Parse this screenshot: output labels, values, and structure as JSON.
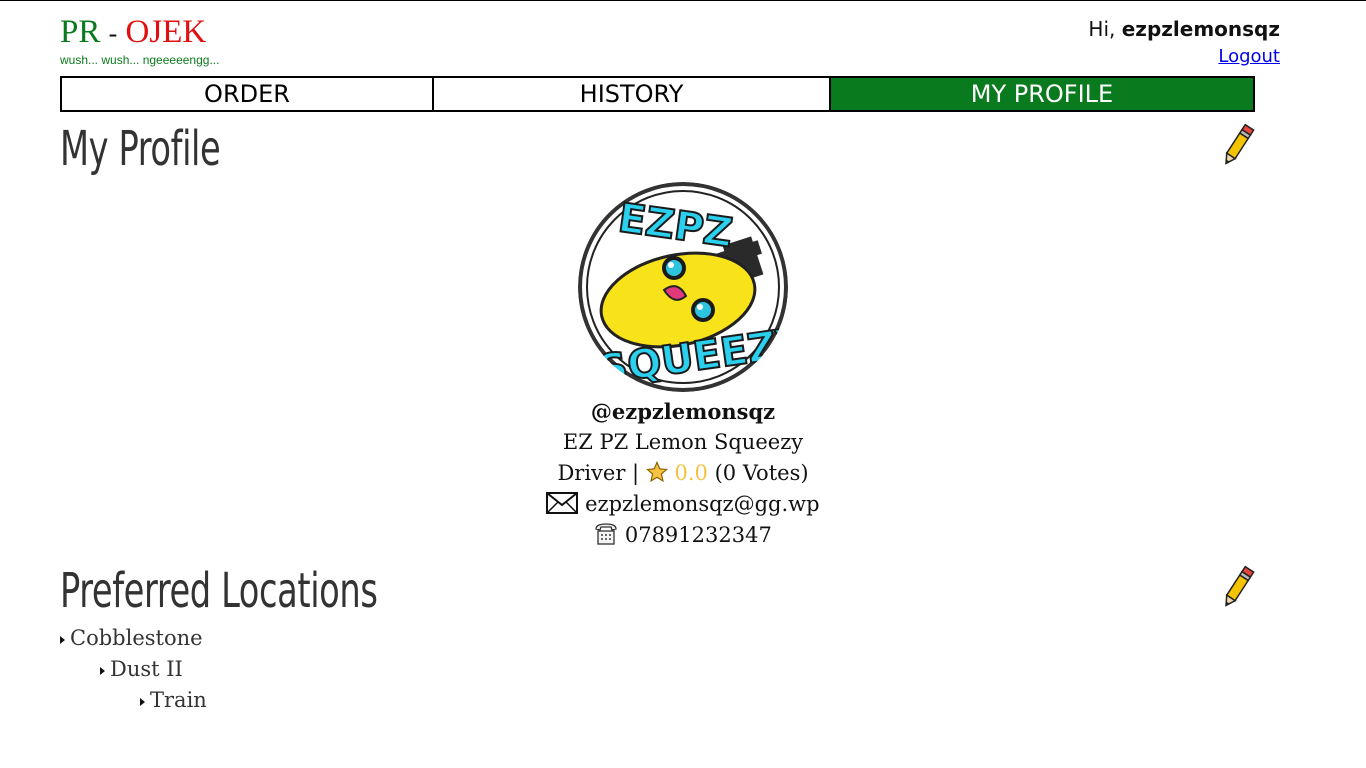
{
  "header": {
    "logo_part1": "PR",
    "logo_sep": "-",
    "logo_part2": "OJEK",
    "tagline": "wush... wush... ngeeeeengg...",
    "greeting": "Hi,",
    "username": "ezpzlemonsqz",
    "logout_label": "Logout"
  },
  "nav": {
    "tabs": [
      {
        "label": "ORDER"
      },
      {
        "label": "HISTORY"
      },
      {
        "label": "MY PROFILE"
      }
    ],
    "active_color": "#0a7a1e"
  },
  "profile": {
    "title": "My Profile",
    "handle": "@ezpzlemonsqz",
    "full_name": "EZ PZ Lemon Squeezy",
    "role": "Driver",
    "separator": "|",
    "rating": "0.0",
    "votes": "(0 Votes)",
    "email": "ezpzlemonsqz@gg.wp",
    "phone": "07891232347",
    "avatar_text_top": "EZPZ",
    "avatar_text_bottom": "SQUEEZY",
    "edit_icon": "pencil-icon",
    "email_icon": "envelope-icon",
    "phone_icon": "telephone-icon",
    "rating_icon": "star-icon"
  },
  "locations": {
    "title": "Preferred Locations",
    "items": [
      "Cobblestone",
      "Dust II",
      "Train"
    ]
  }
}
